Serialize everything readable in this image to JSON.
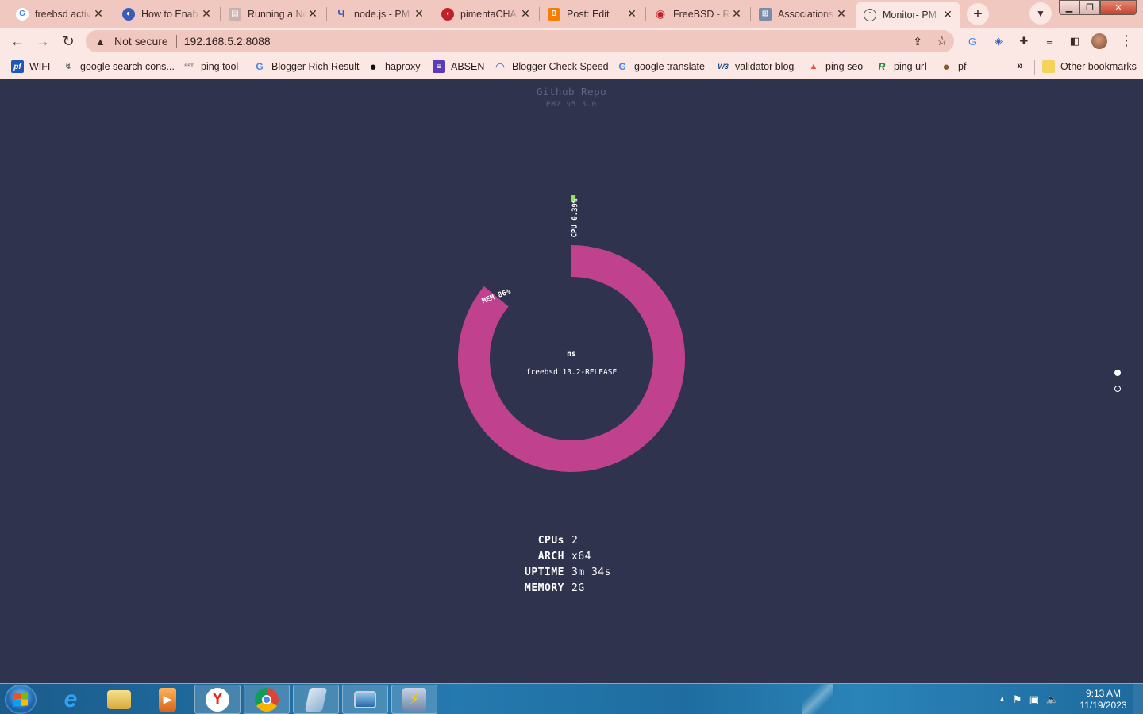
{
  "tabs": [
    {
      "title": "freebsd activ",
      "icon": "google-icon",
      "color": "#4285f4"
    },
    {
      "title": "How to Enab",
      "icon": "browser-globe-icon",
      "color": "#3b5bb8"
    },
    {
      "title": "Running a Nc",
      "icon": "document-icon",
      "color": "#8a7a78"
    },
    {
      "title": "node.js - PM",
      "icon": "stackexchange-icon",
      "color": "#3b5bb8"
    },
    {
      "title": "pimentaCHA",
      "icon": "pimenta-icon",
      "color": "#c0202a"
    },
    {
      "title": "Post: Edit",
      "icon": "blogger-icon",
      "color": "#f57d00"
    },
    {
      "title": "FreeBSD - Ro",
      "icon": "freebsd-icon",
      "color": "#c0202a"
    },
    {
      "title": "Associations",
      "icon": "network-icon",
      "color": "#5a6a8a"
    },
    {
      "title": "Monitor- PM",
      "icon": "gauge-icon",
      "color": "#555"
    }
  ],
  "toolbar": {
    "security_label": "Not secure",
    "url": "192.168.5.2:8088"
  },
  "bookmarks": [
    {
      "label": "WIFI",
      "icon": "pfsense-icon",
      "color": "#2056b8",
      "glyph": "pf"
    },
    {
      "label": "google search cons...",
      "icon": "search-console-icon",
      "color": "#5f6368",
      "glyph": "↯"
    },
    {
      "label": "ping tool",
      "icon": "sst-icon",
      "color": "#777",
      "glyph": "SST"
    },
    {
      "label": "Blogger Rich Result",
      "icon": "google-icon",
      "color": "#4285f4",
      "glyph": "G"
    },
    {
      "label": "haproxy",
      "icon": "github-icon",
      "color": "#111",
      "glyph": "●"
    },
    {
      "label": "ABSEN",
      "icon": "list-icon",
      "color": "#5b3bb8",
      "glyph": "≡"
    },
    {
      "label": "Blogger Check Speed",
      "icon": "speed-icon",
      "color": "#2a62c8",
      "glyph": "◠"
    },
    {
      "label": "google translate",
      "icon": "translate-icon",
      "color": "#4285f4",
      "glyph": "G"
    },
    {
      "label": "validator blog",
      "icon": "w3c-icon",
      "color": "#1a4d8c",
      "glyph": "W3"
    },
    {
      "label": "ping seo",
      "icon": "rocket-icon",
      "color": "#e5533c",
      "glyph": "▲"
    },
    {
      "label": "ping url",
      "icon": "pingurl-icon",
      "color": "#0a8a3a",
      "glyph": "R"
    },
    {
      "label": "pf",
      "icon": "pf-icon",
      "color": "#8a5a2a",
      "glyph": "●"
    }
  ],
  "bookmarks_more": "»",
  "other_bookmarks": "Other bookmarks",
  "page": {
    "repo_link": "Github Repo",
    "version": "PM2 v5.3.0",
    "hostname": "ns",
    "os": "freebsd 13.2-RELEASE",
    "cpu_label": "CPU 0.39%",
    "mem_label": "MEM 86%",
    "cpu_percent": 0.39,
    "mem_percent": 86,
    "cpu_color": "#8ee35a",
    "mem_color": "#c0418e",
    "info": [
      {
        "key": "CPUs",
        "value": "2"
      },
      {
        "key": "ARCH",
        "value": "x64"
      },
      {
        "key": "UPTIME",
        "value": "3m 34s"
      },
      {
        "key": "MEMORY",
        "value": "2G"
      }
    ]
  },
  "taskbar": {
    "items": [
      "start-button",
      "internet-explorer-icon",
      "file-explorer-icon",
      "media-player-icon",
      "yandex-icon",
      "chrome-icon",
      "notepad-icon",
      "remote-desktop-icon",
      "network-tool-icon"
    ],
    "time": "9:13 AM",
    "date": "11/19/2023"
  }
}
